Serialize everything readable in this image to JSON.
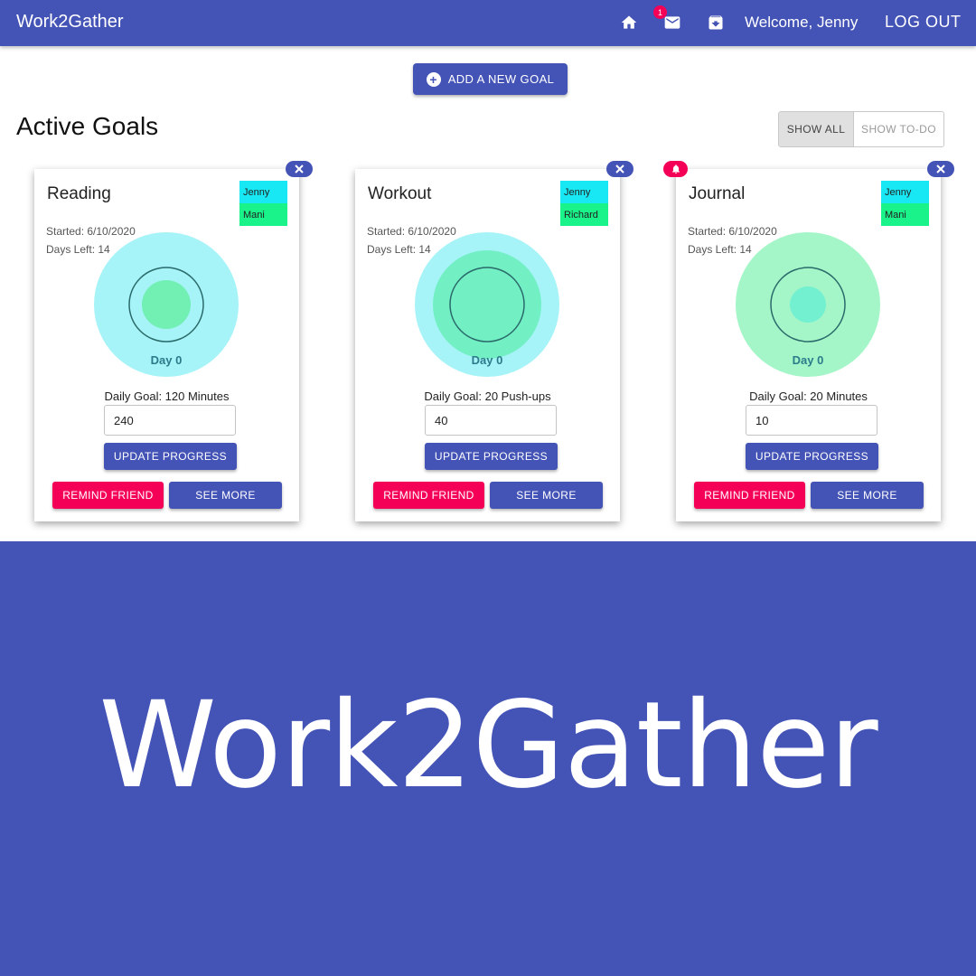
{
  "app": {
    "brand": "Work2Gather",
    "mail_count": "1",
    "welcome": "Welcome, Jenny",
    "logout": "LOG OUT"
  },
  "icons": [
    "home-icon",
    "mail-icon",
    "archive-icon",
    "plus-circle-icon",
    "close-icon",
    "bell-icon"
  ],
  "colors": {
    "primary": "#4353b6",
    "secondary": "#f50057",
    "member_cyan": "#18e8f4",
    "member_green": "#1af28a"
  },
  "actions": {
    "add_goal": "ADD A NEW GOAL"
  },
  "section": {
    "title": "Active Goals"
  },
  "filter": {
    "show_all": "SHOW ALL",
    "show_todo": "SHOW TO-DO",
    "selected": "SHOW ALL"
  },
  "goals": [
    {
      "title": "Reading",
      "members": [
        "Jenny",
        "Mani"
      ],
      "started": "Started: 6/10/2020",
      "days_left": "Days Left: 14",
      "day_label": "Day 0",
      "daily_goal": "Daily Goal: 120 Minutes",
      "progress_value": "240",
      "update_label": "UPDATE PROGRESS",
      "remind_label": "REMIND FRIEND",
      "see_more_label": "SEE MORE",
      "outer_color": "#a6f3f8",
      "inner_color": "#72f0b4",
      "inner_fraction": 0.33,
      "notification": false
    },
    {
      "title": "Workout",
      "members": [
        "Jenny",
        "Richard"
      ],
      "started": "Started: 6/10/2020",
      "days_left": "Days Left: 14",
      "day_label": "Day 0",
      "daily_goal": "Daily Goal: 20 Push-ups",
      "progress_value": "40",
      "update_label": "UPDATE PROGRESS",
      "remind_label": "REMIND FRIEND",
      "see_more_label": "SEE MORE",
      "outer_color": "#a6f3f8",
      "inner_color": "#72f0c4",
      "inner_fraction": 0.75,
      "notification": false
    },
    {
      "title": "Journal",
      "members": [
        "Jenny",
        "Mani"
      ],
      "started": "Started: 6/10/2020",
      "days_left": "Days Left: 14",
      "day_label": "Day 0",
      "daily_goal": "Daily Goal: 20 Minutes",
      "progress_value": "10",
      "update_label": "UPDATE PROGRESS",
      "remind_label": "REMIND FRIEND",
      "see_more_label": "SEE MORE",
      "outer_color": "#a4f6c8",
      "inner_color": "#72f0d0",
      "inner_fraction": 0.25,
      "notification": true
    }
  ],
  "banner": {
    "text": "Work2Gather"
  }
}
